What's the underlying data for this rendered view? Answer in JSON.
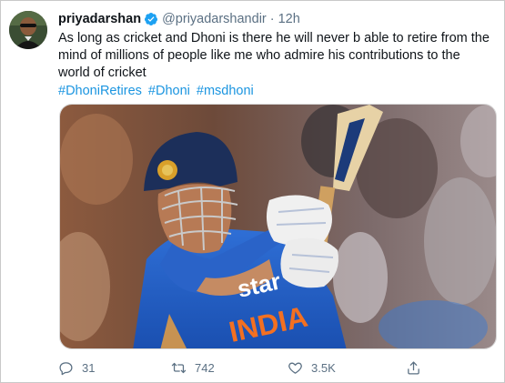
{
  "tweet": {
    "author_name": "priyadarshan",
    "handle": "@priyadarshandir",
    "separator": "·",
    "time": "12h",
    "text": "As long as cricket and Dhoni is there he will  never b able to retire from the\nmind of millions  of people like me who admire his contributions  to the\nworld  of cricket",
    "hashtags": [
      "#DhoniRetires",
      "#Dhoni",
      "#msdhoni"
    ]
  },
  "media": {
    "jersey_text": "INDIA",
    "sponsor_text": "star"
  },
  "actions": {
    "reply_count": "31",
    "retweet_count": "742",
    "like_count": "3.5K"
  },
  "colors": {
    "accent": "#1b95e0",
    "muted": "#5b7083",
    "text": "#0f1419",
    "jersey": "#1e5bc6"
  },
  "icons": {
    "verified": "verified-badge-icon",
    "reply": "reply-icon",
    "retweet": "retweet-icon",
    "like": "heart-icon",
    "share": "share-icon"
  }
}
